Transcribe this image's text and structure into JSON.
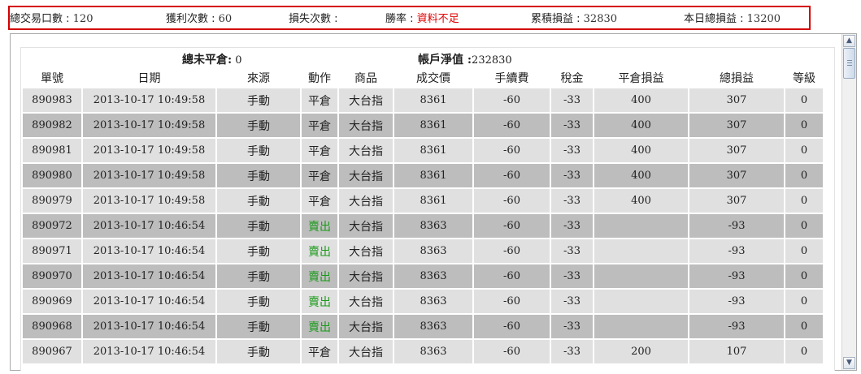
{
  "stats": {
    "total_trades_label": "總交易口數 : ",
    "total_trades": "120",
    "wins_label": "獲利次數 : ",
    "wins": "60",
    "losses_label": "損失次數 : ",
    "losses": "",
    "win_rate_label": "勝率 : ",
    "win_rate": "資料不足",
    "cumulative_label": "累積損益 : ",
    "cumulative": "32830",
    "today_label": "本日總損益 : ",
    "today": "13200"
  },
  "summary": {
    "open_label": "總未平倉:",
    "open_value": " 0",
    "equity_label": "帳戶淨值 :",
    "equity_value": "232830"
  },
  "table": {
    "headers": [
      "單號",
      "日期",
      "來源",
      "動作",
      "商品",
      "成交價",
      "手續費",
      "稅金",
      "平倉損益",
      "總損益",
      "等級"
    ],
    "rows": [
      {
        "id": "890983",
        "date": "2013-10-17 10:49:58",
        "source": "手動",
        "action": "平倉",
        "product": "大台指",
        "price": "8361",
        "fee": "-60",
        "tax": "-33",
        "close_pl": "400",
        "total_pl": "307",
        "level": "0",
        "action_color": "normal"
      },
      {
        "id": "890982",
        "date": "2013-10-17 10:49:58",
        "source": "手動",
        "action": "平倉",
        "product": "大台指",
        "price": "8361",
        "fee": "-60",
        "tax": "-33",
        "close_pl": "400",
        "total_pl": "307",
        "level": "0",
        "action_color": "normal"
      },
      {
        "id": "890981",
        "date": "2013-10-17 10:49:58",
        "source": "手動",
        "action": "平倉",
        "product": "大台指",
        "price": "8361",
        "fee": "-60",
        "tax": "-33",
        "close_pl": "400",
        "total_pl": "307",
        "level": "0",
        "action_color": "normal"
      },
      {
        "id": "890980",
        "date": "2013-10-17 10:49:58",
        "source": "手動",
        "action": "平倉",
        "product": "大台指",
        "price": "8361",
        "fee": "-60",
        "tax": "-33",
        "close_pl": "400",
        "total_pl": "307",
        "level": "0",
        "action_color": "normal"
      },
      {
        "id": "890979",
        "date": "2013-10-17 10:49:58",
        "source": "手動",
        "action": "平倉",
        "product": "大台指",
        "price": "8361",
        "fee": "-60",
        "tax": "-33",
        "close_pl": "400",
        "total_pl": "307",
        "level": "0",
        "action_color": "normal"
      },
      {
        "id": "890972",
        "date": "2013-10-17 10:46:54",
        "source": "手動",
        "action": "賣出",
        "product": "大台指",
        "price": "8363",
        "fee": "-60",
        "tax": "-33",
        "close_pl": "",
        "total_pl": "-93",
        "level": "0",
        "action_color": "green"
      },
      {
        "id": "890971",
        "date": "2013-10-17 10:46:54",
        "source": "手動",
        "action": "賣出",
        "product": "大台指",
        "price": "8363",
        "fee": "-60",
        "tax": "-33",
        "close_pl": "",
        "total_pl": "-93",
        "level": "0",
        "action_color": "green"
      },
      {
        "id": "890970",
        "date": "2013-10-17 10:46:54",
        "source": "手動",
        "action": "賣出",
        "product": "大台指",
        "price": "8363",
        "fee": "-60",
        "tax": "-33",
        "close_pl": "",
        "total_pl": "-93",
        "level": "0",
        "action_color": "green"
      },
      {
        "id": "890969",
        "date": "2013-10-17 10:46:54",
        "source": "手動",
        "action": "賣出",
        "product": "大台指",
        "price": "8363",
        "fee": "-60",
        "tax": "-33",
        "close_pl": "",
        "total_pl": "-93",
        "level": "0",
        "action_color": "green"
      },
      {
        "id": "890968",
        "date": "2013-10-17 10:46:54",
        "source": "手動",
        "action": "賣出",
        "product": "大台指",
        "price": "8363",
        "fee": "-60",
        "tax": "-33",
        "close_pl": "",
        "total_pl": "-93",
        "level": "0",
        "action_color": "green"
      },
      {
        "id": "890967",
        "date": "2013-10-17 10:46:54",
        "source": "手動",
        "action": "平倉",
        "product": "大台指",
        "price": "8363",
        "fee": "-60",
        "tax": "-33",
        "close_pl": "200",
        "total_pl": "107",
        "level": "0",
        "action_color": "normal"
      }
    ]
  },
  "colors": {
    "win_rate": "#e00000",
    "sell_action": "#1a9a1a",
    "highlight_border": "#d40000",
    "row_light": "#e0e0e0",
    "row_dark": "#bdbdbd"
  },
  "icons": {
    "scroll_up": "▲",
    "scroll_down": "▼"
  }
}
